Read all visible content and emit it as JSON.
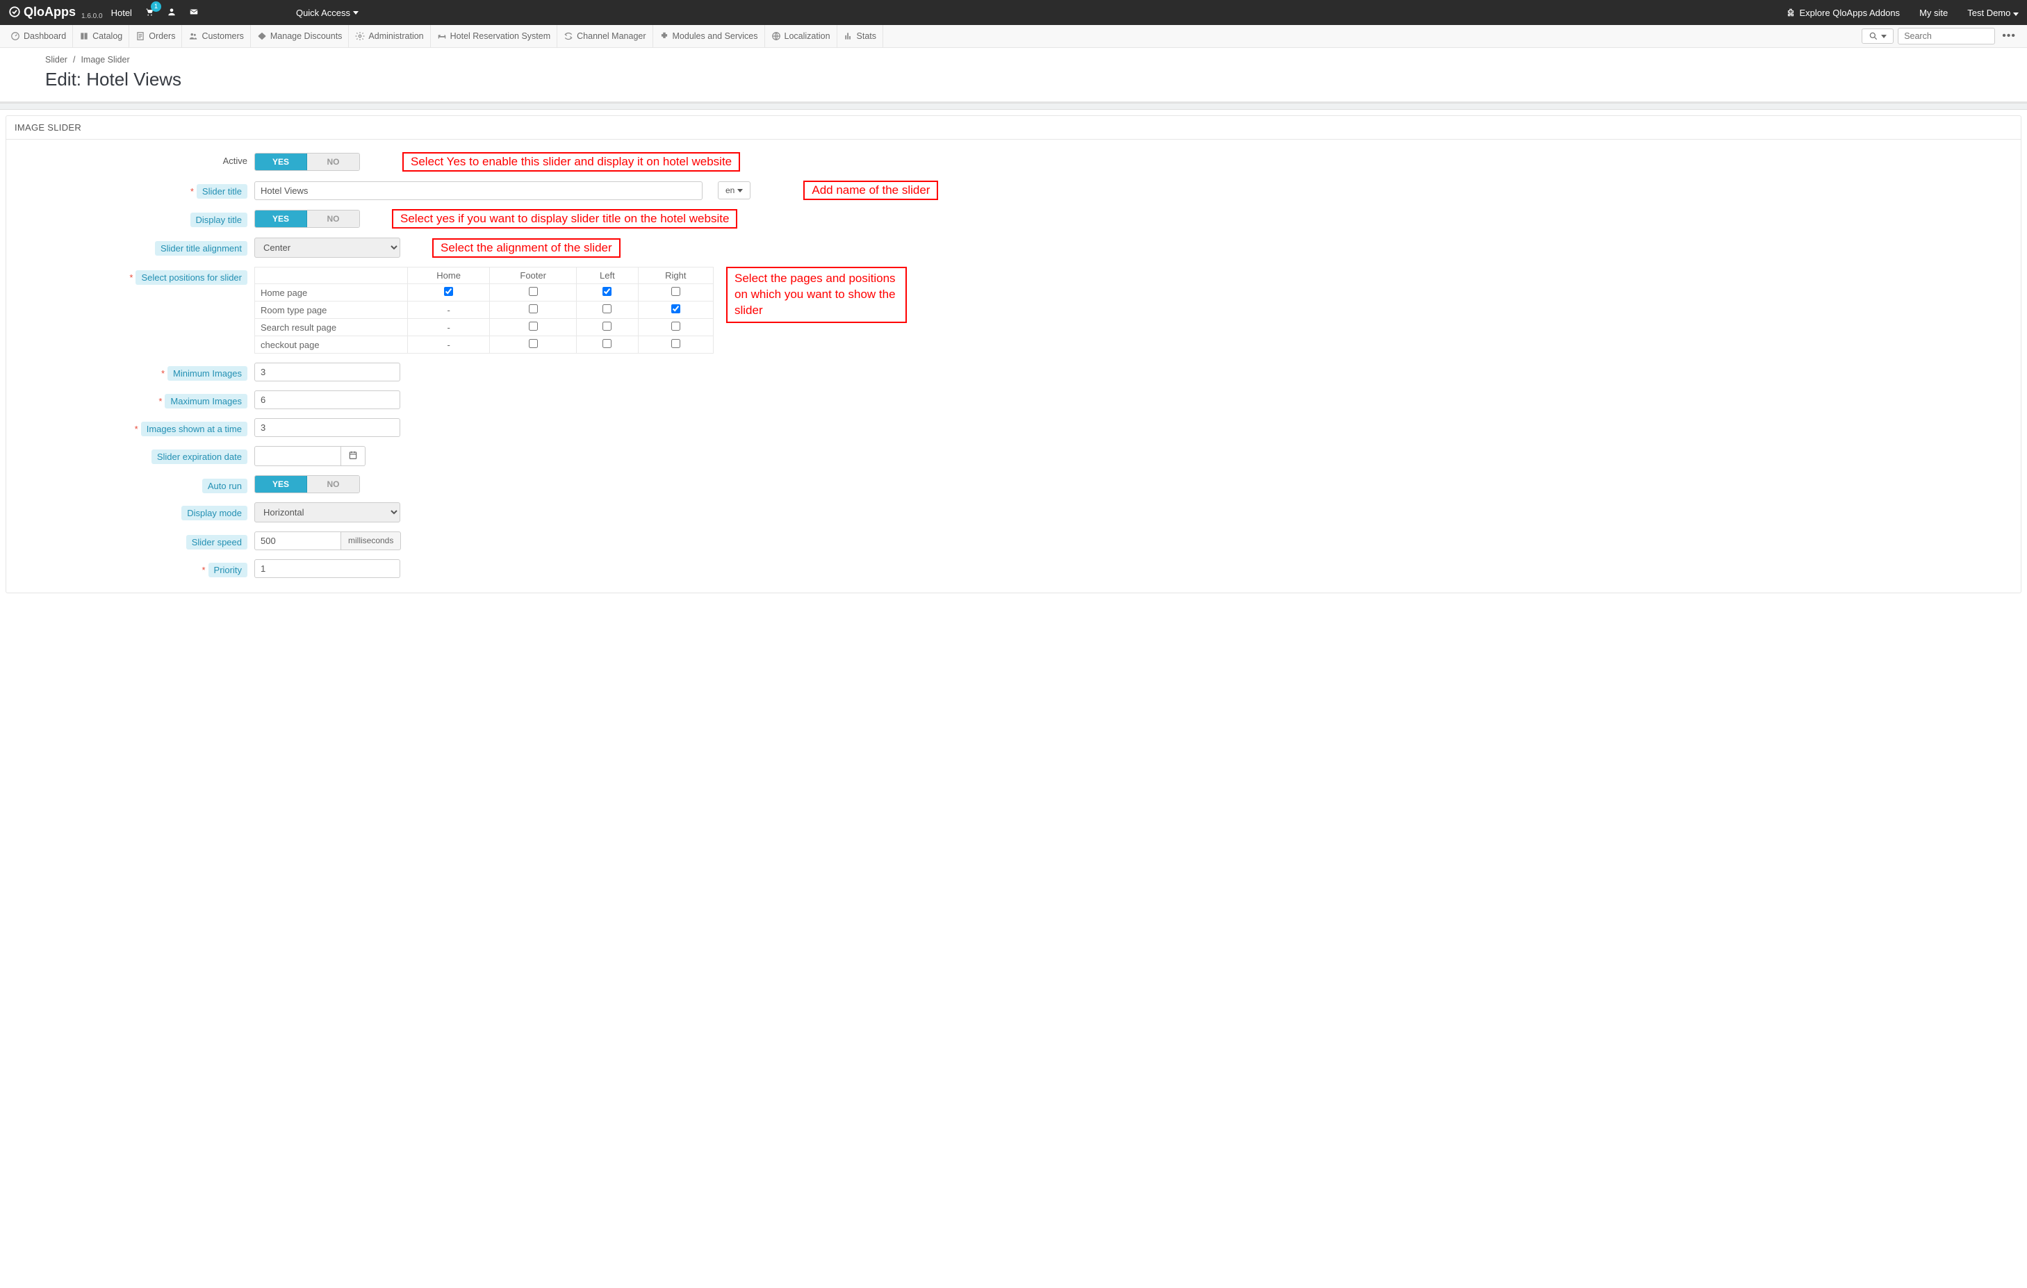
{
  "topbar": {
    "brand": "QloApps",
    "version": "1.6.0.0",
    "context": "Hotel",
    "cart_badge": "1",
    "quick_access": "Quick Access",
    "addons": "Explore QloApps Addons",
    "mysite": "My site",
    "user": "Test Demo"
  },
  "mainnav": {
    "items": [
      "Dashboard",
      "Catalog",
      "Orders",
      "Customers",
      "Manage Discounts",
      "Administration",
      "Hotel Reservation System",
      "Channel Manager",
      "Modules and Services",
      "Localization",
      "Stats"
    ],
    "search_placeholder": "Search"
  },
  "breadcrumb": {
    "a": "Slider",
    "sep": "/",
    "b": "Image Slider"
  },
  "page_title": "Edit: Hotel Views",
  "panel_heading": "IMAGE SLIDER",
  "form": {
    "active_label": "Active",
    "yes": "YES",
    "no": "NO",
    "slider_title_label": "Slider title",
    "slider_title_value": "Hotel Views",
    "lang": "en",
    "display_title_label": "Display title",
    "alignment_label": "Slider title alignment",
    "alignment_value": "Center",
    "positions_label": "Select positions for slider",
    "positions_cols": [
      "",
      "Home",
      "Footer",
      "Left",
      "Right"
    ],
    "positions_rows": [
      {
        "name": "Home page",
        "c": [
          "cb:true",
          "cb:false",
          "cb:true",
          "cb:false"
        ]
      },
      {
        "name": "Room type page",
        "c": [
          "dash",
          "cb:false",
          "cb:false",
          "cb:true"
        ]
      },
      {
        "name": "Search result page",
        "c": [
          "dash",
          "cb:false",
          "cb:false",
          "cb:false"
        ]
      },
      {
        "name": "checkout page",
        "c": [
          "dash",
          "cb:false",
          "cb:false",
          "cb:false"
        ]
      }
    ],
    "min_label": "Minimum Images",
    "min_value": "3",
    "max_label": "Maximum Images",
    "max_value": "6",
    "shown_label": "Images shown at a time",
    "shown_value": "3",
    "expire_label": "Slider expiration date",
    "expire_value": "",
    "autorun_label": "Auto run",
    "displaymode_label": "Display mode",
    "displaymode_value": "Horizontal",
    "speed_label": "Slider speed",
    "speed_value": "500",
    "speed_unit": "milliseconds",
    "priority_label": "Priority",
    "priority_value": "1"
  },
  "callouts": {
    "active": "Select Yes to enable this slider and display it on hotel website",
    "title": "Add name of the slider",
    "display": "Select yes if you want to display slider title on the hotel website",
    "align": "Select the alignment of the slider",
    "positions": "Select the pages and positions on which you want to show the slider"
  }
}
